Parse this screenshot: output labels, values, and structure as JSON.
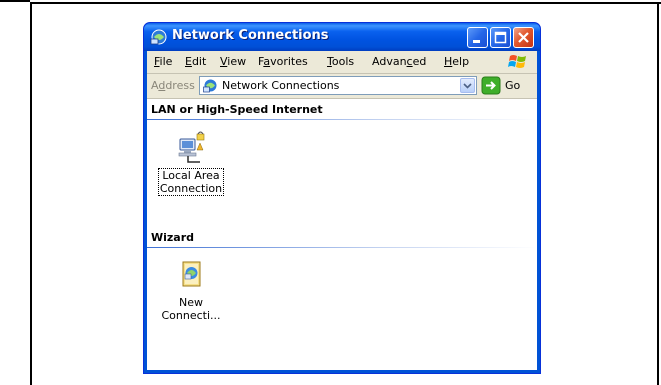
{
  "window": {
    "title": "Network Connections"
  },
  "menubar": {
    "items": [
      {
        "pre": "",
        "u": "F",
        "post": "ile"
      },
      {
        "pre": "",
        "u": "E",
        "post": "dit"
      },
      {
        "pre": "",
        "u": "V",
        "post": "iew"
      },
      {
        "pre": "F",
        "u": "a",
        "post": "vorites"
      },
      {
        "pre": "",
        "u": "T",
        "post": "ools"
      },
      {
        "pre": "Advan",
        "u": "c",
        "post": "ed"
      },
      {
        "pre": "",
        "u": "H",
        "post": "elp"
      }
    ]
  },
  "addressbar": {
    "label_pre": "A",
    "label_u": "d",
    "label_post": "dress",
    "value": "Network Connections",
    "go_label": "Go"
  },
  "groups": [
    {
      "title": "LAN or High-Speed Internet",
      "items": [
        {
          "line1": "Local Area",
          "line2": "Connection",
          "icon": "lan-connection-icon"
        }
      ]
    },
    {
      "title": "Wizard",
      "items": [
        {
          "line1": "New",
          "line2": "Connecti...",
          "icon": "new-connection-wizard-icon"
        }
      ]
    }
  ],
  "colors": {
    "title_blue": "#0054e3",
    "client_bg": "#ece9d8",
    "close_red": "#e2582e"
  }
}
